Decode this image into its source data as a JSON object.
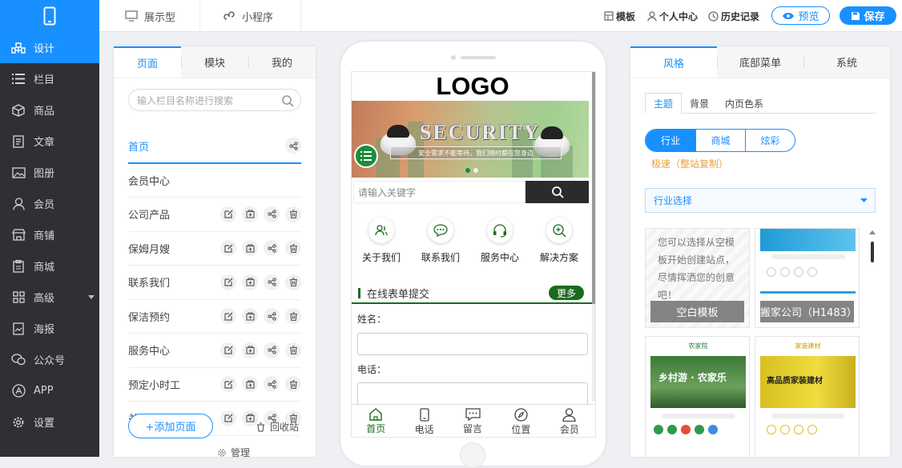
{
  "top": {
    "tabs": [
      {
        "label": "展示型"
      },
      {
        "label": "小程序"
      }
    ],
    "right_links": [
      {
        "label": "模板"
      },
      {
        "label": "个人中心"
      },
      {
        "label": "历史记录"
      }
    ],
    "preview_label": "预览",
    "save_label": "保存"
  },
  "nav": {
    "items": [
      {
        "label": "设计",
        "icon": "design-icon",
        "active": true
      },
      {
        "label": "栏目",
        "icon": "list-icon"
      },
      {
        "label": "商品",
        "icon": "box-icon"
      },
      {
        "label": "文章",
        "icon": "article-icon"
      },
      {
        "label": "图册",
        "icon": "image-icon"
      },
      {
        "label": "会员",
        "icon": "user-icon"
      },
      {
        "label": "商铺",
        "icon": "shop-icon"
      },
      {
        "label": "商城",
        "icon": "mall-icon"
      },
      {
        "label": "高级",
        "icon": "grid-icon",
        "has_caret": true
      },
      {
        "label": "海报",
        "icon": "poster-icon"
      },
      {
        "label": "公众号",
        "icon": "wechat-icon"
      },
      {
        "label": "APP",
        "icon": "app-icon"
      },
      {
        "label": "设置",
        "icon": "gear-icon"
      }
    ]
  },
  "pages_panel": {
    "tabs": [
      {
        "label": "页面",
        "active": true
      },
      {
        "label": "模块"
      },
      {
        "label": "我的"
      }
    ],
    "search_placeholder": "输入栏目名称进行搜索",
    "pages": [
      {
        "label": "首页",
        "active": true
      },
      {
        "label": "会员中心"
      },
      {
        "label": "公司产品"
      },
      {
        "label": "保姆月嫂"
      },
      {
        "label": "联系我们"
      },
      {
        "label": "保洁预约"
      },
      {
        "label": "服务中心"
      },
      {
        "label": "预定小时工"
      },
      {
        "label": "关于我们"
      }
    ],
    "add_page_label": "+添加页面",
    "recycle_label": "回收站",
    "manage_label": "管理"
  },
  "phone": {
    "logo_text": "LOGO",
    "banner_title": "SECURITY",
    "banner_subtitle": "安全需求不能等待，我们随时都在您身边",
    "search_placeholder": "请输入关键字",
    "quick_icons": [
      {
        "label": "关于我们",
        "icon": "about-icon"
      },
      {
        "label": "联系我们",
        "icon": "chat-icon"
      },
      {
        "label": "服务中心",
        "icon": "headset-icon"
      },
      {
        "label": "解决方案",
        "icon": "solution-icon"
      }
    ],
    "form_title": "在线表单提交",
    "more_label": "更多",
    "field_name_label": "姓名：",
    "field_phone_label": "电话：",
    "tabbar": [
      {
        "label": "首页",
        "icon": "home-icon",
        "active": true
      },
      {
        "label": "电话",
        "icon": "phone-icon"
      },
      {
        "label": "留言",
        "icon": "message-icon"
      },
      {
        "label": "位置",
        "icon": "compass-icon"
      },
      {
        "label": "会员",
        "icon": "member-icon"
      }
    ],
    "accent_color": "#1b6b1e"
  },
  "style_panel": {
    "tabs": [
      {
        "label": "风格",
        "active": true
      },
      {
        "label": "底部菜单"
      },
      {
        "label": "系统"
      }
    ],
    "subtabs": [
      {
        "label": "主题",
        "active": true
      },
      {
        "label": "背景"
      },
      {
        "label": "内页色系"
      }
    ],
    "segments": [
      {
        "label": "行业",
        "active": true
      },
      {
        "label": "商城"
      },
      {
        "label": "炫彩"
      }
    ],
    "fast_label": "极速（整站复制）",
    "industry_select": "行业选择",
    "blank_template_text": "您可以选择从空模板开始创建站点，尽情挥洒您的创意吧！",
    "blank_template_caption": "空白模板",
    "moving_template_caption": "搬家公司（H1483）",
    "farm_template_title": "乡村游 · 农家乐",
    "farm_template_brand": "农家院",
    "deco_template_title": "高品质家装建材",
    "deco_template_brand": "家装建材"
  },
  "colors": {
    "brand": "#1890ff",
    "nav_bg": "#2f3033"
  }
}
